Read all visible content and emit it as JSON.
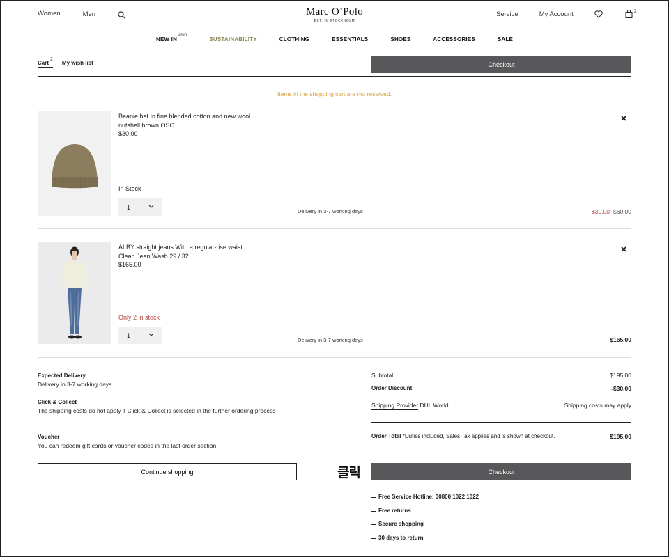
{
  "header": {
    "nav_women": "Women",
    "nav_men": "Men",
    "logo": "Marc O’Polo",
    "logo_sub": "EST. IN STOCKHOLM",
    "service": "Service",
    "my_account": "My Account",
    "bag_count": "2"
  },
  "main_nav": {
    "new_in": "NEW IN",
    "new_in_count": "466",
    "sustainability": "SUSTAINABILITY",
    "clothing": "CLOTHING",
    "essentials": "ESSENTIALS",
    "shoes": "SHOES",
    "accessories": "ACCESSORIES",
    "sale": "SALE"
  },
  "cart": {
    "tab_cart": "Cart",
    "cart_count": "2",
    "tab_wishlist": "My wish list",
    "checkout_label": "Checkout",
    "notice": "Items in the shopping cart are not reserved."
  },
  "items": [
    {
      "line1": "Beanie hat In fine blended cotton and new wool",
      "line2": "nutshell brown OSO",
      "price": "$30.00",
      "stock": "In Stock",
      "qty": "1",
      "delivery": "Delivery in 3-7 working days",
      "sale_price": "$30.00",
      "old_price": "$60.00"
    },
    {
      "line1": "ALBY straight jeans With a regular-rise waist",
      "line2": "Clean Jean Wash 29 / 32",
      "price": "$165.00",
      "stock": "Only 2 in stock",
      "qty": "1",
      "delivery": "Delivery in 3-7 working days",
      "total": "$165.00"
    }
  ],
  "info": {
    "expected_title": "Expected Delivery",
    "expected_text": "Delivery in 3-7 working days",
    "click_title": "Click & Collect",
    "click_text": "The shipping costs do not apply if Click & Collect is selected in the further ordering process",
    "voucher_title": "Voucher",
    "voucher_text": "You can redeem gift cards or voucher codes in the last order section!"
  },
  "summary": {
    "subtotal_label": "Subtotal",
    "subtotal": "$195.00",
    "discount_label": "Order Discount",
    "discount": "-$30.00",
    "shipping_label": "Shipping Provider",
    "shipping_provider": "DHL World",
    "shipping_note": "Shipping costs may apply",
    "total_label": "Order Total",
    "total_note": "*Duties included, Sales Tax applies and is shown at checkout.",
    "total": "$195.00"
  },
  "buttons": {
    "continue": "Continue shopping",
    "checkout": "Checkout",
    "click_annotation": "클릭"
  },
  "benefits": [
    "Free Service Hotline: 00800 1022 1022",
    "Free returns",
    "Secure shopping",
    "30 days to return"
  ],
  "colors": {
    "accent_green": "#8d8b5a",
    "sale_red": "#b3473e",
    "notice_orange": "#d9a23f",
    "button_dark": "#58585a"
  }
}
